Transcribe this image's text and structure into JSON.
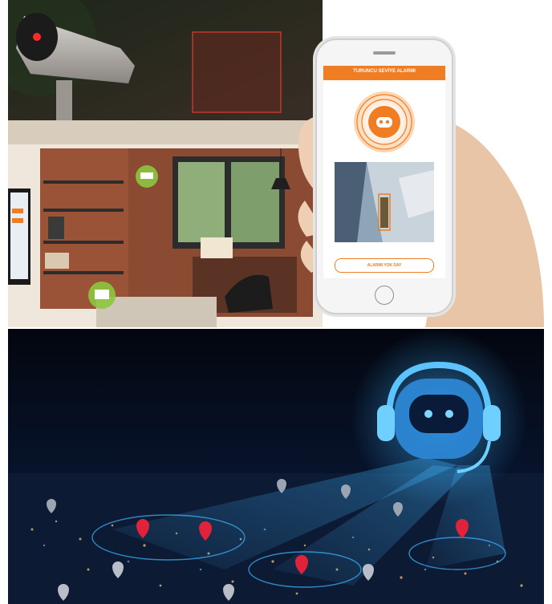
{
  "top_scene": {
    "phone": {
      "header_title": "TURUNCU SEVİYE ALARMI",
      "button_label": "ALARMI YOK SAY",
      "colors": {
        "accent": "#f07d22",
        "screen_bg": "#ffffff"
      }
    },
    "icons": [
      "camera-icon",
      "router-icon",
      "monitor-icon",
      "robot-face-icon"
    ]
  },
  "bottom_scene": {
    "icons": [
      "robot-headset-icon",
      "location-pin-icon"
    ],
    "colors": {
      "glow": "#3fb6ff",
      "pin_red": "#e0233a",
      "pin_grey": "#9aa4b2"
    }
  }
}
